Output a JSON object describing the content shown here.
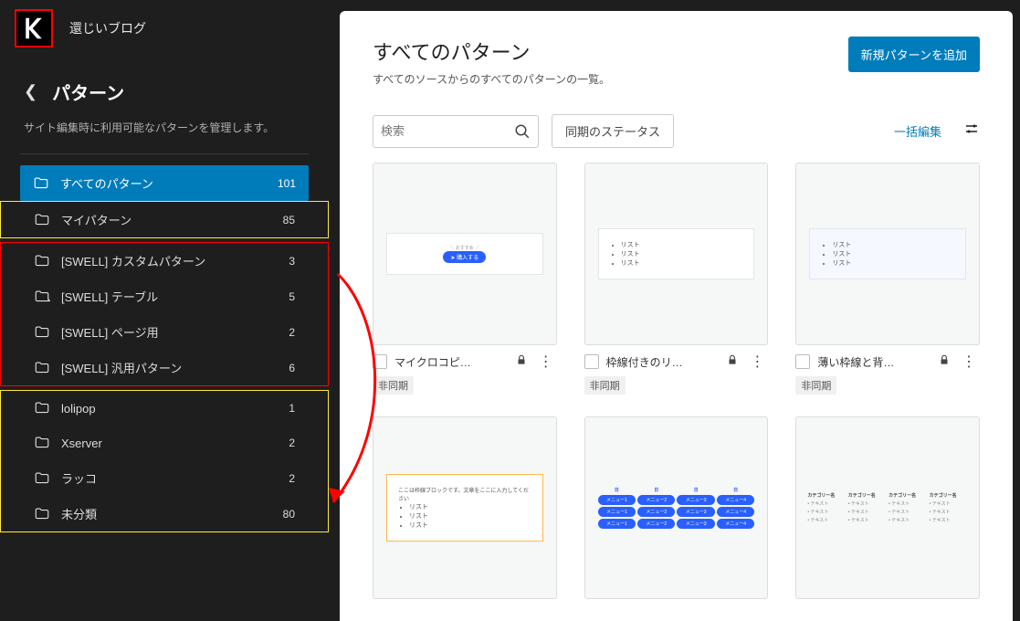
{
  "topbar": {
    "site_title": "還じいブログ"
  },
  "sidebar": {
    "title": "パターン",
    "description": "サイト編集時に利用可能なパターンを管理します。",
    "active": {
      "label": "すべてのパターン",
      "count": 101
    },
    "group_my": [
      {
        "label": "マイパターン",
        "count": 85
      }
    ],
    "group_swell": [
      {
        "label": "[SWELL] カスタムパターン",
        "count": 3
      },
      {
        "label": "[SWELL] テーブル",
        "count": 5
      },
      {
        "label": "[SWELL] ページ用",
        "count": 2
      },
      {
        "label": "[SWELL] 汎用パターン",
        "count": 6
      }
    ],
    "group_other": [
      {
        "label": "lolipop",
        "count": 1
      },
      {
        "label": "Xserver",
        "count": 2
      },
      {
        "label": "ラッコ",
        "count": 2
      },
      {
        "label": "未分類",
        "count": 80
      }
    ]
  },
  "main": {
    "title": "すべてのパターン",
    "subtitle": "すべてのソースからのすべてのパターンの一覧。",
    "add_button": "新規パターンを追加",
    "search_placeholder": "検索",
    "sync_status_chip": "同期のステータス",
    "bulk_edit": "一括編集",
    "cards_row1": [
      {
        "title": "マイクロコピ…",
        "sync": "非同期"
      },
      {
        "title": "枠線付きのリ…",
        "sync": "非同期"
      },
      {
        "title": "薄い枠線と背…",
        "sync": "非同期"
      }
    ],
    "cards_row2": [
      {
        "title": "",
        "sync": ""
      },
      {
        "title": "",
        "sync": ""
      },
      {
        "title": "",
        "sync": ""
      }
    ]
  }
}
